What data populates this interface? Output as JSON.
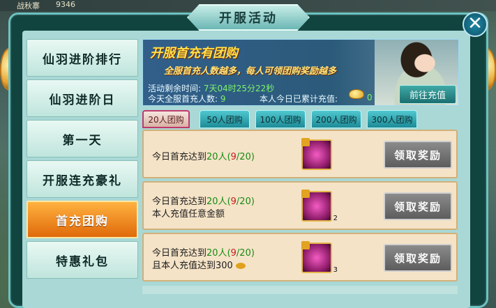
{
  "top_strip": {
    "rank_label": "战秋寨",
    "number": "9346"
  },
  "window": {
    "title": "开服活动",
    "close_symbol": "✕"
  },
  "sidebar": {
    "items": [
      {
        "label": "仙羽进阶排行",
        "active": false
      },
      {
        "label": "仙羽进阶日",
        "active": false
      },
      {
        "label": "第一天",
        "active": false
      },
      {
        "label": "开服连充豪礼",
        "active": false
      },
      {
        "label": "首充团购",
        "active": true
      },
      {
        "label": "特惠礼包",
        "active": false
      }
    ]
  },
  "banner": {
    "headline": "开服首充有团购",
    "subline": "全服首充人数越多，每人可领团购奖励越多"
  },
  "stats": {
    "remaining_label": "活动剩余时间:",
    "remaining_value": "7天04时25分22秒",
    "server_first_label": "今天全服首充人数:",
    "server_first_value": "9",
    "personal_label": "本人今日已累计充值:",
    "personal_value": "0",
    "recharge_button": "前往充值"
  },
  "tabs": [
    {
      "label": "20人团购",
      "active": true
    },
    {
      "label": "50人团购",
      "active": false
    },
    {
      "label": "100人团购",
      "active": false
    },
    {
      "label": "200人团购",
      "active": false
    },
    {
      "label": "300人团购",
      "active": false
    }
  ],
  "rewards": [
    {
      "line1_prefix": "今日首充达到",
      "line1_target": "20人",
      "line1_open": "(",
      "line1_current": "9",
      "line1_total": "/20)",
      "line2": "",
      "count": "",
      "button": "领取奖励"
    },
    {
      "line1_prefix": "今日首充达到",
      "line1_target": "20人",
      "line1_open": "(",
      "line1_current": "9",
      "line1_total": "/20)",
      "line2": "本人充值任意金额",
      "count": "2",
      "button": "领取奖励"
    },
    {
      "line1_prefix": "今日首充达到",
      "line1_target": "20人",
      "line1_open": "(",
      "line1_current": "9",
      "line1_total": "/20)",
      "line2": "且本人充值达到300",
      "count": "3",
      "button": "领取奖励"
    }
  ],
  "icons": {
    "gold_icon": "gold-ingot-icon",
    "gift_icon": "pink-orb-gift-icon",
    "lock_icon": "lock-icon"
  },
  "colors": {
    "active_tab_border": "#c0396b",
    "accent_orange": "#e06a0b",
    "frame_teal": "#6bc3c2"
  }
}
